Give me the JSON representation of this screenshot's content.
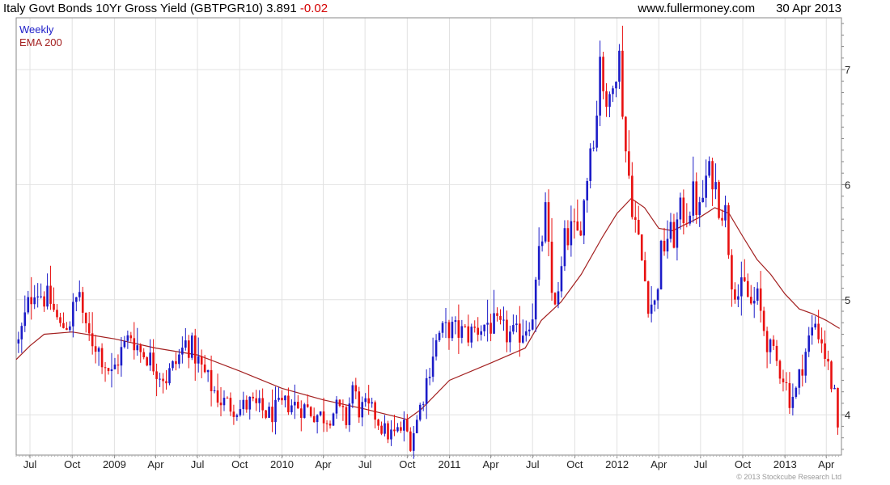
{
  "header": {
    "name": "Italy Govt Bonds 10Yr Gross Yield (GBTPGR10)",
    "last": "3.891",
    "change": "-0.02",
    "site": "www.fullermoney.com",
    "date": "30 Apr 2013"
  },
  "legend": {
    "frequency": "Weekly",
    "indicator": "EMA 200"
  },
  "copyright": "© 2013 Stockcube Research Ltd",
  "colors": {
    "up": "#1c1cc8",
    "down": "#e81010",
    "ema": "#a32020",
    "grid": "#e2e2e2",
    "axis": "#8a8a8a"
  },
  "chart_data": {
    "type": "candlestick",
    "frequency": "weekly",
    "ylim": [
      3.65,
      7.45
    ],
    "yticks": [
      4,
      5,
      6,
      7
    ],
    "xlim": [
      "2008-06-01",
      "2013-05-04"
    ],
    "xticks": [
      {
        "label": "Jul",
        "date": "2008-07-01"
      },
      {
        "label": "Oct",
        "date": "2008-10-01"
      },
      {
        "label": "2009",
        "date": "2009-01-01"
      },
      {
        "label": "Apr",
        "date": "2009-04-01"
      },
      {
        "label": "Jul",
        "date": "2009-07-01"
      },
      {
        "label": "Oct",
        "date": "2009-10-01"
      },
      {
        "label": "2010",
        "date": "2010-01-01"
      },
      {
        "label": "Apr",
        "date": "2010-04-01"
      },
      {
        "label": "Jul",
        "date": "2010-07-01"
      },
      {
        "label": "Oct",
        "date": "2010-10-01"
      },
      {
        "label": "2011",
        "date": "2011-01-01"
      },
      {
        "label": "Apr",
        "date": "2011-04-01"
      },
      {
        "label": "Jul",
        "date": "2011-07-01"
      },
      {
        "label": "Oct",
        "date": "2011-10-01"
      },
      {
        "label": "2012",
        "date": "2012-01-01"
      },
      {
        "label": "Apr",
        "date": "2012-04-01"
      },
      {
        "label": "Jul",
        "date": "2012-07-01"
      },
      {
        "label": "Oct",
        "date": "2012-10-01"
      },
      {
        "label": "2013",
        "date": "2013-01-01"
      },
      {
        "label": "Apr",
        "date": "2013-04-01"
      }
    ],
    "close_path": [
      [
        "2008-06-06",
        4.62
      ],
      [
        "2008-06-27",
        4.95
      ],
      [
        "2008-07-11",
        5.12
      ],
      [
        "2008-07-25",
        5.05
      ],
      [
        "2008-08-15",
        4.98
      ],
      [
        "2008-09-05",
        4.75
      ],
      [
        "2008-09-26",
        4.82
      ],
      [
        "2008-10-17",
        5.08
      ],
      [
        "2008-10-31",
        4.7
      ],
      [
        "2008-11-21",
        4.62
      ],
      [
        "2008-12-12",
        4.45
      ],
      [
        "2008-12-26",
        4.35
      ],
      [
        "2009-01-16",
        4.55
      ],
      [
        "2009-02-06",
        4.7
      ],
      [
        "2009-02-27",
        4.55
      ],
      [
        "2009-03-13",
        4.52
      ],
      [
        "2009-04-03",
        4.4
      ],
      [
        "2009-04-24",
        4.32
      ],
      [
        "2009-05-15",
        4.45
      ],
      [
        "2009-06-05",
        4.62
      ],
      [
        "2009-06-19",
        4.58
      ],
      [
        "2009-07-10",
        4.4
      ],
      [
        "2009-07-31",
        4.25
      ],
      [
        "2009-08-21",
        4.12
      ],
      [
        "2009-09-11",
        4.08
      ],
      [
        "2009-10-02",
        4.05
      ],
      [
        "2009-10-23",
        4.1
      ],
      [
        "2009-11-13",
        4.05
      ],
      [
        "2009-12-04",
        4.0
      ],
      [
        "2009-12-25",
        4.05
      ],
      [
        "2010-01-15",
        4.1
      ],
      [
        "2010-02-05",
        4.08
      ],
      [
        "2010-02-26",
        4.05
      ],
      [
        "2010-03-19",
        4.0
      ],
      [
        "2010-04-09",
        3.98
      ],
      [
        "2010-04-30",
        4.05
      ],
      [
        "2010-05-21",
        3.95
      ],
      [
        "2010-06-04",
        4.25
      ],
      [
        "2010-06-18",
        4.05
      ],
      [
        "2010-07-02",
        4.05
      ],
      [
        "2010-07-23",
        4.0
      ],
      [
        "2010-08-13",
        3.85
      ],
      [
        "2010-09-03",
        3.82
      ],
      [
        "2010-09-24",
        3.9
      ],
      [
        "2010-10-08",
        3.78
      ],
      [
        "2010-10-22",
        3.95
      ],
      [
        "2010-11-12",
        4.3
      ],
      [
        "2010-11-26",
        4.55
      ],
      [
        "2010-12-10",
        4.7
      ],
      [
        "2010-12-31",
        4.75
      ],
      [
        "2011-01-21",
        4.72
      ],
      [
        "2011-02-11",
        4.7
      ],
      [
        "2011-03-04",
        4.75
      ],
      [
        "2011-03-25",
        4.8
      ],
      [
        "2011-04-15",
        4.75
      ],
      [
        "2011-05-06",
        4.7
      ],
      [
        "2011-05-27",
        4.68
      ],
      [
        "2011-06-17",
        4.78
      ],
      [
        "2011-07-01",
        4.9
      ],
      [
        "2011-07-15",
        5.35
      ],
      [
        "2011-07-29",
        5.75
      ],
      [
        "2011-08-12",
        5.05
      ],
      [
        "2011-08-26",
        5.0
      ],
      [
        "2011-09-09",
        5.5
      ],
      [
        "2011-09-23",
        5.6
      ],
      [
        "2011-10-07",
        5.55
      ],
      [
        "2011-10-21",
        5.85
      ],
      [
        "2011-11-04",
        6.35
      ],
      [
        "2011-11-18",
        6.6
      ],
      [
        "2011-11-25",
        7.2
      ],
      [
        "2011-12-09",
        6.55
      ],
      [
        "2011-12-23",
        7.0
      ],
      [
        "2012-01-06",
        7.1
      ],
      [
        "2012-01-20",
        6.3
      ],
      [
        "2012-02-03",
        5.85
      ],
      [
        "2012-02-17",
        5.5
      ],
      [
        "2012-03-09",
        5.0
      ],
      [
        "2012-03-23",
        4.95
      ],
      [
        "2012-04-06",
        5.4
      ],
      [
        "2012-04-20",
        5.55
      ],
      [
        "2012-05-04",
        5.55
      ],
      [
        "2012-05-18",
        5.75
      ],
      [
        "2012-06-01",
        5.75
      ],
      [
        "2012-06-15",
        5.9
      ],
      [
        "2012-06-29",
        5.75
      ],
      [
        "2012-07-13",
        6.05
      ],
      [
        "2012-07-27",
        6.1
      ],
      [
        "2012-08-10",
        5.85
      ],
      [
        "2012-08-24",
        5.75
      ],
      [
        "2012-09-07",
        5.2
      ],
      [
        "2012-09-21",
        5.05
      ],
      [
        "2012-10-05",
        5.1
      ],
      [
        "2012-10-19",
        4.95
      ],
      [
        "2012-11-02",
        5.0
      ],
      [
        "2012-11-16",
        4.75
      ],
      [
        "2012-11-30",
        4.55
      ],
      [
        "2012-12-14",
        4.45
      ],
      [
        "2012-12-28",
        4.35
      ],
      [
        "2013-01-11",
        4.15
      ],
      [
        "2013-01-25",
        4.2
      ],
      [
        "2013-02-08",
        4.45
      ],
      [
        "2013-02-22",
        4.65
      ],
      [
        "2013-03-08",
        4.8
      ],
      [
        "2013-03-22",
        4.65
      ],
      [
        "2013-04-05",
        4.4
      ],
      [
        "2013-04-19",
        4.15
      ],
      [
        "2013-04-30",
        3.89
      ]
    ],
    "ema_200": [
      [
        "2008-06-01",
        4.48
      ],
      [
        "2008-07-01",
        4.6
      ],
      [
        "2008-08-01",
        4.7
      ],
      [
        "2008-10-01",
        4.72
      ],
      [
        "2009-01-01",
        4.66
      ],
      [
        "2009-04-01",
        4.58
      ],
      [
        "2009-07-01",
        4.52
      ],
      [
        "2009-10-01",
        4.38
      ],
      [
        "2010-01-01",
        4.23
      ],
      [
        "2010-04-01",
        4.13
      ],
      [
        "2010-07-01",
        4.05
      ],
      [
        "2010-10-01",
        3.96
      ],
      [
        "2010-11-01",
        4.05
      ],
      [
        "2011-01-01",
        4.3
      ],
      [
        "2011-04-01",
        4.45
      ],
      [
        "2011-06-15",
        4.58
      ],
      [
        "2011-07-20",
        4.82
      ],
      [
        "2011-09-01",
        4.98
      ],
      [
        "2011-10-15",
        5.22
      ],
      [
        "2011-12-01",
        5.55
      ],
      [
        "2012-01-01",
        5.75
      ],
      [
        "2012-02-01",
        5.88
      ],
      [
        "2012-03-01",
        5.8
      ],
      [
        "2012-04-01",
        5.62
      ],
      [
        "2012-05-01",
        5.6
      ],
      [
        "2012-06-01",
        5.66
      ],
      [
        "2012-07-01",
        5.72
      ],
      [
        "2012-08-01",
        5.8
      ],
      [
        "2012-09-01",
        5.75
      ],
      [
        "2012-10-01",
        5.55
      ],
      [
        "2012-11-01",
        5.35
      ],
      [
        "2012-12-01",
        5.22
      ],
      [
        "2013-01-01",
        5.05
      ],
      [
        "2013-02-01",
        4.92
      ],
      [
        "2013-03-01",
        4.88
      ],
      [
        "2013-04-01",
        4.82
      ],
      [
        "2013-04-30",
        4.75
      ]
    ]
  }
}
